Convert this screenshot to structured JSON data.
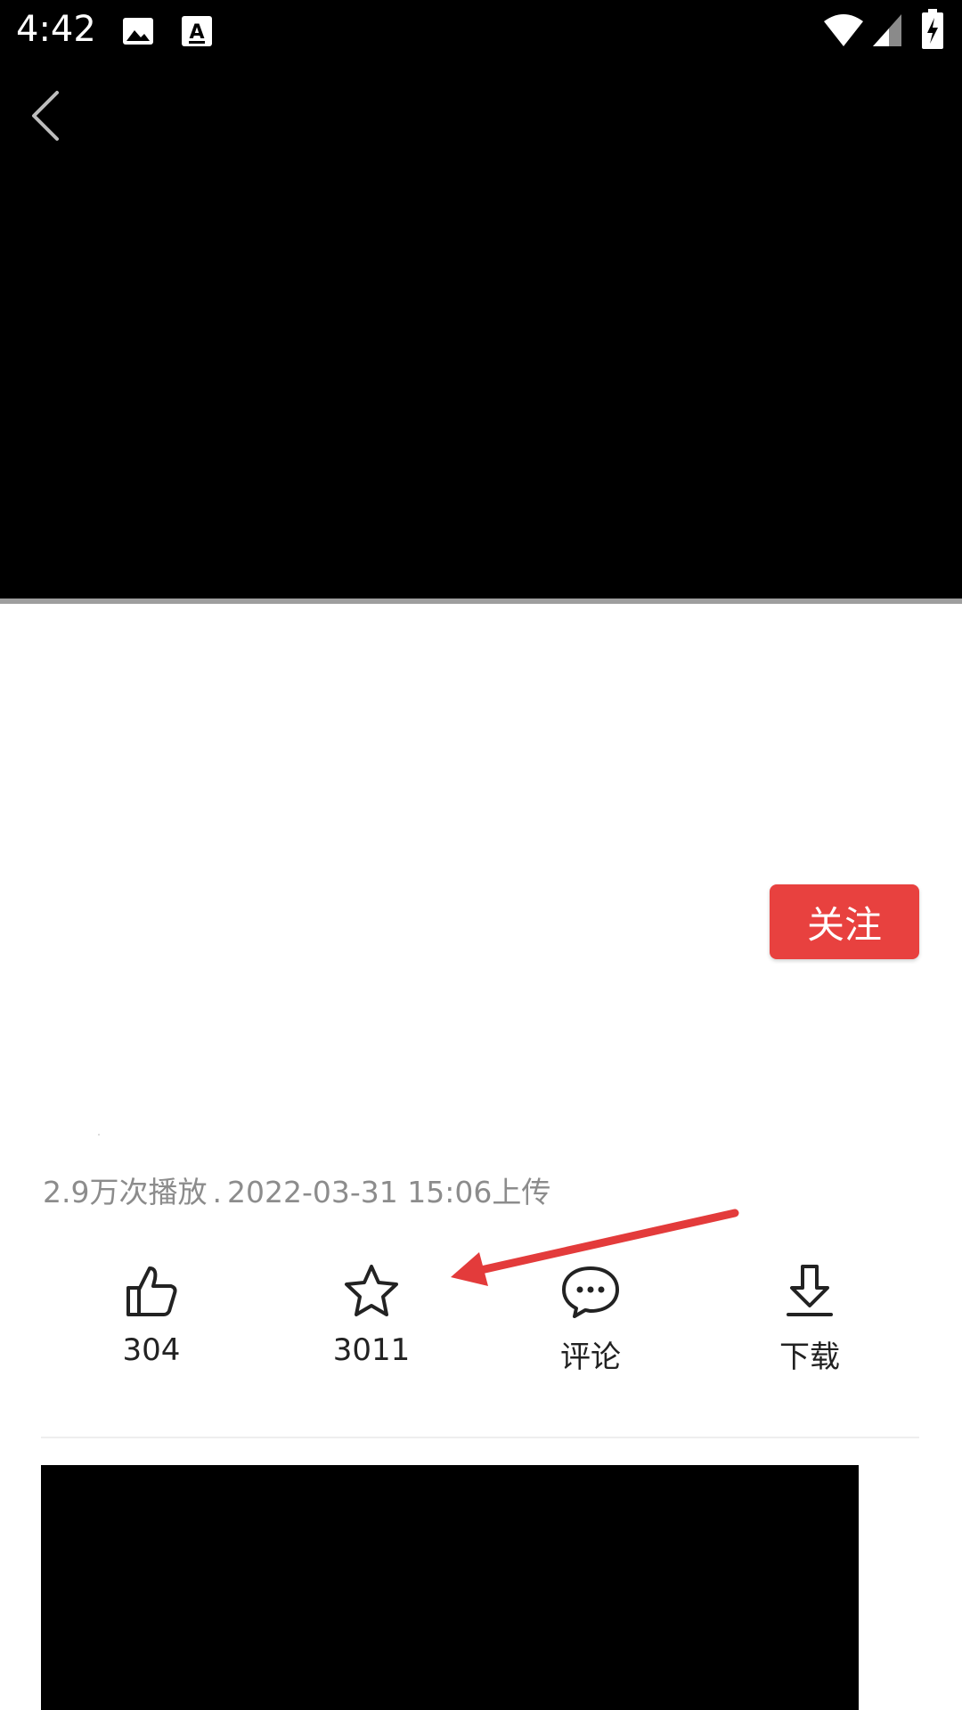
{
  "status_bar": {
    "time": "4:42",
    "icons": [
      "image-icon",
      "keyboard-a-icon",
      "wifi-icon",
      "signal-icon",
      "battery-charging-icon"
    ]
  },
  "player": {
    "back_icon": "back-arrow-icon"
  },
  "follow_button": {
    "label": "关注",
    "color": "#e8413f"
  },
  "video_meta": {
    "views": "2.9万次播放",
    "separator": ".",
    "upload": "2022-03-31 15:06上传"
  },
  "actions": [
    {
      "icon": "thumbs-up-icon",
      "label": "304"
    },
    {
      "icon": "star-icon",
      "label": "3011"
    },
    {
      "icon": "comment-icon",
      "label": "评论"
    },
    {
      "icon": "download-icon",
      "label": "下载"
    }
  ],
  "annotation": {
    "arrow_color": "#e33b3b"
  }
}
